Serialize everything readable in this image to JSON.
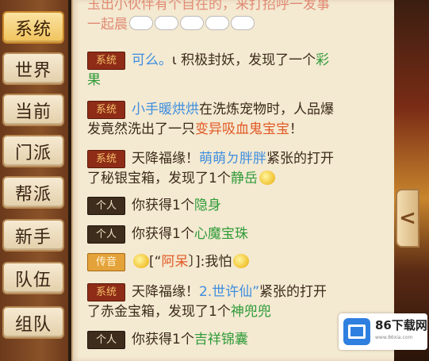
{
  "tabs": [
    "系统",
    "世界",
    "当前",
    "门派",
    "帮派",
    "新手",
    "队伍",
    "组队"
  ],
  "active_tab": "系统",
  "messages": {
    "m0": {
      "line1": "玉出小伙伴有个自在的，来打招呼一发事",
      "line2": "一起晨"
    },
    "m1": {
      "badge": "系统",
      "name": "可么。",
      "text1": "ι 积极封妖，发现了一个",
      "item_a": "彩",
      "item_b": "果"
    },
    "m2": {
      "badge": "系统",
      "name": "小手暖烘烘",
      "text1": "在洗炼宠物时，人品爆",
      "text2": "发竟然洗出了一只",
      "pet": "变异吸血鬼宝宝",
      "end": "！"
    },
    "m3": {
      "badge": "系统",
      "text1": "天降福缘！",
      "name": "萌萌ㄉ胖胖",
      "text2": "紧张的打开",
      "text3": "了秘银宝箱，发现了1个",
      "item": "静岳"
    },
    "m4": {
      "badge": "个人",
      "text": "你获得1个",
      "item": "隐身"
    },
    "m5": {
      "badge": "个人",
      "text": "你获得1个",
      "item": "心魔宝珠"
    },
    "m6": {
      "badge": "传音",
      "text": "[“",
      "name": "阿呆",
      "text2": "〕]:我怕"
    },
    "m7": {
      "badge": "系统",
      "text1": "天降福缘！",
      "name": "2.世许仙”",
      "text2": "紧张的打开",
      "text3": "了赤金宝箱，发现了1个",
      "item": "神兜兜"
    },
    "m8": {
      "badge": "个人",
      "text": "你获得1个",
      "item": "吉祥锦囊"
    }
  },
  "collapse_arrow": "<",
  "watermark": {
    "brand": "86下载网",
    "sub": "www.86xia.com"
  },
  "colors": {
    "system_badge": "#8e2c17",
    "personal_badge": "#3e2c1c",
    "player_name": "#3d8ee0",
    "item": "#2f9c3a",
    "pet": "#e25a26"
  }
}
